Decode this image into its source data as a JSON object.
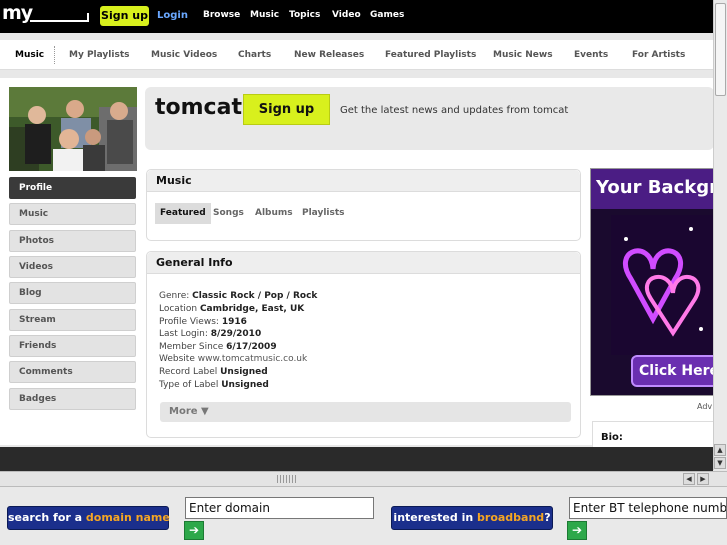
{
  "topbar": {
    "logo": "my",
    "signup": "Sign up",
    "login": "Login",
    "nav": [
      "Browse",
      "Music",
      "Topics",
      "Video",
      "Games"
    ]
  },
  "subnav": [
    "Music",
    "My Playlists",
    "Music Videos",
    "Charts",
    "New Releases",
    "Featured Playlists",
    "Music News",
    "Events",
    "For Artists"
  ],
  "profile": {
    "username": "tomcat",
    "signup": "Sign up",
    "tagline": "Get the latest news and updates from tomcat"
  },
  "sidebar": [
    "Profile",
    "Music",
    "Photos",
    "Videos",
    "Blog",
    "Stream",
    "Friends",
    "Comments",
    "Badges"
  ],
  "music_panel": {
    "title": "Music",
    "tabs": [
      "Featured",
      "Songs",
      "Albums",
      "Playlists"
    ]
  },
  "general_info": {
    "title": "General Info",
    "genre_label": "Genre:",
    "genre_value": "Classic Rock / Pop / Rock",
    "location_label": "Location",
    "location_value": "Cambridge, East, UK",
    "views_label": "Profile Views:",
    "views_value": "1916",
    "login_label": "Last Login:",
    "login_value": "8/29/2010",
    "since_label": "Member Since",
    "since_value": "6/17/2009",
    "website_label": "Website",
    "website_value": "www.tomcatmusic.co.uk",
    "record_label": "Record Label",
    "record_value": "Unsigned",
    "type_label": "Type of Label",
    "type_value": "Unsigned",
    "more": "More ▼"
  },
  "ad": {
    "title": "Your Backgr",
    "cta": "Click Here",
    "label": "Adv"
  },
  "bio_label": "Bio:",
  "bottom": {
    "domain_btn_a": "search for a ",
    "domain_btn_b": "domain name",
    "domain_input": "Enter domain",
    "broadband_btn_a": "interested in ",
    "broadband_btn_b": "broadband",
    "broadband_btn_c": "?",
    "phone_input": "Enter BT telephone numbe"
  }
}
